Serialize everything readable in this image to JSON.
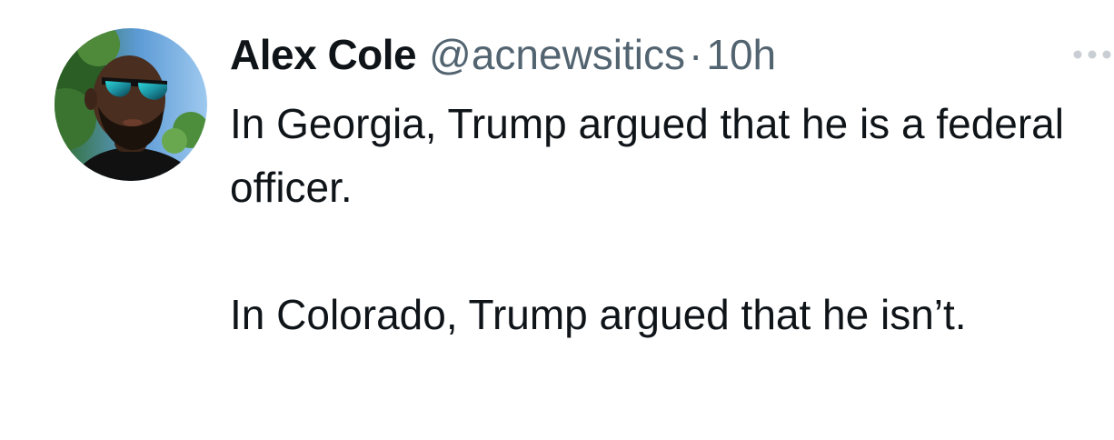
{
  "tweet": {
    "author": {
      "display_name": "Alex Cole",
      "handle": "@acnewsitics",
      "avatar_icon": "profile-photo"
    },
    "separator": "·",
    "timestamp": "10h",
    "more_icon": "more-horizontal-icon",
    "text": {
      "paragraph_1": "In Georgia, Trump argued that he is a federal officer.",
      "paragraph_2": "In Colorado, Trump argued that he isn’t."
    }
  },
  "colors": {
    "text_primary": "#0f1419",
    "text_secondary": "#536471",
    "background": "#ffffff"
  }
}
